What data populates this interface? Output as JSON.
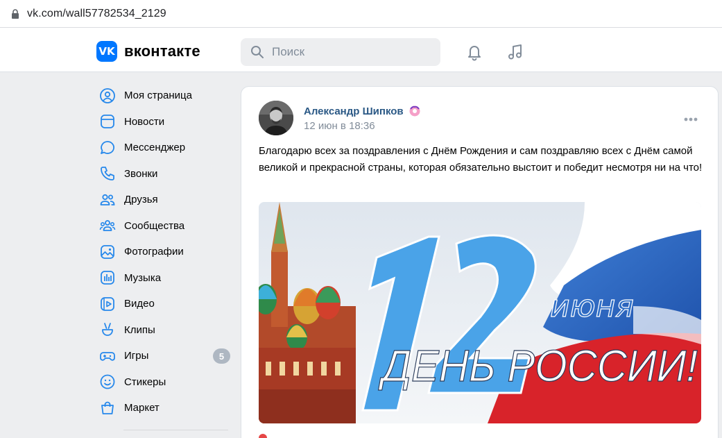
{
  "browser": {
    "url": "vk.com/wall57782534_2129",
    "lock_icon": "lock-icon"
  },
  "header": {
    "logo_text": "вконтакте",
    "logo_mark": "VK",
    "search_placeholder": "Поиск",
    "icons": [
      "search-icon",
      "bell-icon",
      "music-note-icon"
    ],
    "brand_color": "#0077ff"
  },
  "sidebar": {
    "items": [
      {
        "label": "Моя страница",
        "icon": "profile-icon"
      },
      {
        "label": "Новости",
        "icon": "news-icon"
      },
      {
        "label": "Мессенджер",
        "icon": "messenger-icon"
      },
      {
        "label": "Звонки",
        "icon": "phone-icon"
      },
      {
        "label": "Друзья",
        "icon": "friends-icon"
      },
      {
        "label": "Сообщества",
        "icon": "communities-icon"
      },
      {
        "label": "Фотографии",
        "icon": "photos-icon"
      },
      {
        "label": "Музыка",
        "icon": "music-icon"
      },
      {
        "label": "Видео",
        "icon": "video-icon"
      },
      {
        "label": "Клипы",
        "icon": "clips-icon"
      },
      {
        "label": "Игры",
        "icon": "games-icon",
        "badge": "5"
      },
      {
        "label": "Стикеры",
        "icon": "stickers-icon"
      },
      {
        "label": "Маркет",
        "icon": "market-icon"
      }
    ],
    "icon_color": "#2688eb"
  },
  "post": {
    "author": "Александр Шипков",
    "date": "12 июн в 18:36",
    "text": "Благодарю всех за поздравления с Днём Рождения и сам поздравляю всех с Днём самой великой и прекрасной страны, которая обязательно выстоит и победит несмотря ни на что!",
    "image": {
      "big_number": "12",
      "subtitle": "июня",
      "headline": "ДЕНЬ РОССИИ!"
    },
    "author_color": "#2a5885",
    "date_color": "#818c99"
  }
}
